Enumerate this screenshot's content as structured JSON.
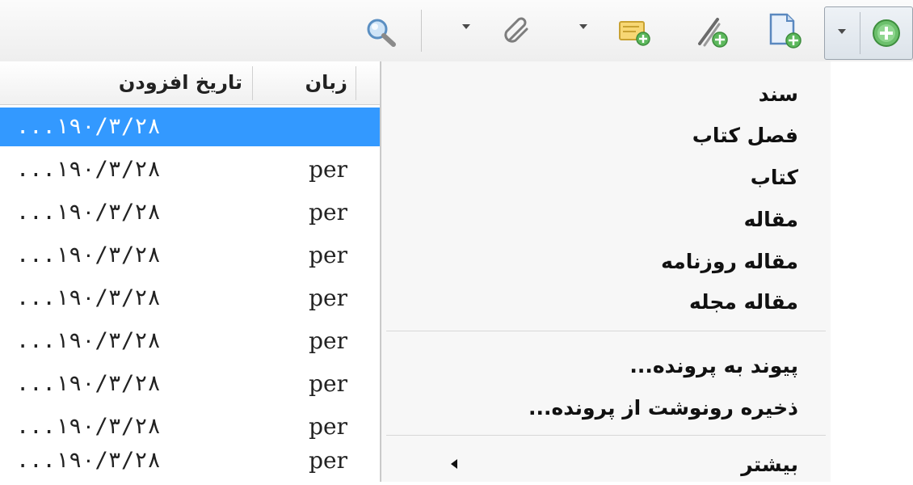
{
  "toolbar": {
    "icons": [
      {
        "name": "magnifier-icon"
      },
      {
        "name": "paperclip-icon"
      },
      {
        "name": "new-note-icon"
      },
      {
        "name": "edit-item-icon"
      },
      {
        "name": "new-document-icon"
      },
      {
        "name": "add-icon"
      }
    ]
  },
  "table": {
    "headers": {
      "language": "زبان",
      "date_added": "تاریخ افزودن"
    },
    "rows": [
      {
        "date": "...۱۹۰/۳/۲۸",
        "lang": ""
      },
      {
        "date": "...۱۹۰/۳/۲۸",
        "lang": "per"
      },
      {
        "date": "...۱۹۰/۳/۲۸",
        "lang": "per"
      },
      {
        "date": "...۱۹۰/۳/۲۸",
        "lang": "per"
      },
      {
        "date": "...۱۹۰/۳/۲۸",
        "lang": "per"
      },
      {
        "date": "...۱۹۰/۳/۲۸",
        "lang": "per"
      },
      {
        "date": "...۱۹۰/۳/۲۸",
        "lang": "per"
      },
      {
        "date": "...۱۹۰/۳/۲۸",
        "lang": "per"
      },
      {
        "date": "...۱۹۰/۳/۲۸",
        "lang": "per"
      }
    ]
  },
  "menu": {
    "item_types": [
      "سند",
      "فصل کتاب",
      "کتاب",
      "مقاله",
      "مقاله روزنامه",
      "مقاله مجله"
    ],
    "file_actions": [
      "پیوند به پرونده...",
      "ذخیره رونوشت از پرونده..."
    ],
    "more": "بیشتر"
  },
  "colors": {
    "selection": "#3399ff",
    "add_green": "#4caf50",
    "menu_bg": "#f7f7f7"
  }
}
